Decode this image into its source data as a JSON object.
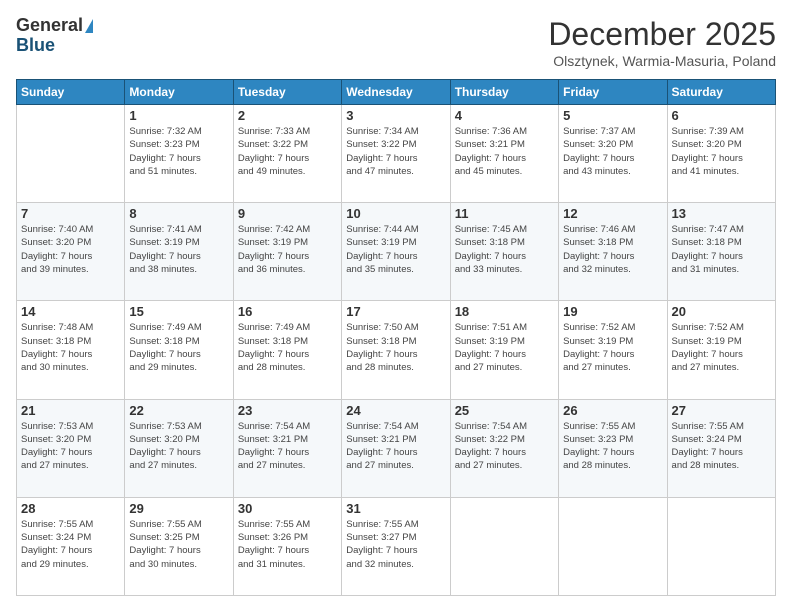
{
  "logo": {
    "general": "General",
    "blue": "Blue"
  },
  "title": "December 2025",
  "location": "Olsztynek, Warmia-Masuria, Poland",
  "days_header": [
    "Sunday",
    "Monday",
    "Tuesday",
    "Wednesday",
    "Thursday",
    "Friday",
    "Saturday"
  ],
  "weeks": [
    [
      {
        "day": "",
        "info": ""
      },
      {
        "day": "1",
        "info": "Sunrise: 7:32 AM\nSunset: 3:23 PM\nDaylight: 7 hours\nand 51 minutes."
      },
      {
        "day": "2",
        "info": "Sunrise: 7:33 AM\nSunset: 3:22 PM\nDaylight: 7 hours\nand 49 minutes."
      },
      {
        "day": "3",
        "info": "Sunrise: 7:34 AM\nSunset: 3:22 PM\nDaylight: 7 hours\nand 47 minutes."
      },
      {
        "day": "4",
        "info": "Sunrise: 7:36 AM\nSunset: 3:21 PM\nDaylight: 7 hours\nand 45 minutes."
      },
      {
        "day": "5",
        "info": "Sunrise: 7:37 AM\nSunset: 3:20 PM\nDaylight: 7 hours\nand 43 minutes."
      },
      {
        "day": "6",
        "info": "Sunrise: 7:39 AM\nSunset: 3:20 PM\nDaylight: 7 hours\nand 41 minutes."
      }
    ],
    [
      {
        "day": "7",
        "info": "Sunrise: 7:40 AM\nSunset: 3:20 PM\nDaylight: 7 hours\nand 39 minutes."
      },
      {
        "day": "8",
        "info": "Sunrise: 7:41 AM\nSunset: 3:19 PM\nDaylight: 7 hours\nand 38 minutes."
      },
      {
        "day": "9",
        "info": "Sunrise: 7:42 AM\nSunset: 3:19 PM\nDaylight: 7 hours\nand 36 minutes."
      },
      {
        "day": "10",
        "info": "Sunrise: 7:44 AM\nSunset: 3:19 PM\nDaylight: 7 hours\nand 35 minutes."
      },
      {
        "day": "11",
        "info": "Sunrise: 7:45 AM\nSunset: 3:18 PM\nDaylight: 7 hours\nand 33 minutes."
      },
      {
        "day": "12",
        "info": "Sunrise: 7:46 AM\nSunset: 3:18 PM\nDaylight: 7 hours\nand 32 minutes."
      },
      {
        "day": "13",
        "info": "Sunrise: 7:47 AM\nSunset: 3:18 PM\nDaylight: 7 hours\nand 31 minutes."
      }
    ],
    [
      {
        "day": "14",
        "info": "Sunrise: 7:48 AM\nSunset: 3:18 PM\nDaylight: 7 hours\nand 30 minutes."
      },
      {
        "day": "15",
        "info": "Sunrise: 7:49 AM\nSunset: 3:18 PM\nDaylight: 7 hours\nand 29 minutes."
      },
      {
        "day": "16",
        "info": "Sunrise: 7:49 AM\nSunset: 3:18 PM\nDaylight: 7 hours\nand 28 minutes."
      },
      {
        "day": "17",
        "info": "Sunrise: 7:50 AM\nSunset: 3:18 PM\nDaylight: 7 hours\nand 28 minutes."
      },
      {
        "day": "18",
        "info": "Sunrise: 7:51 AM\nSunset: 3:19 PM\nDaylight: 7 hours\nand 27 minutes."
      },
      {
        "day": "19",
        "info": "Sunrise: 7:52 AM\nSunset: 3:19 PM\nDaylight: 7 hours\nand 27 minutes."
      },
      {
        "day": "20",
        "info": "Sunrise: 7:52 AM\nSunset: 3:19 PM\nDaylight: 7 hours\nand 27 minutes."
      }
    ],
    [
      {
        "day": "21",
        "info": "Sunrise: 7:53 AM\nSunset: 3:20 PM\nDaylight: 7 hours\nand 27 minutes."
      },
      {
        "day": "22",
        "info": "Sunrise: 7:53 AM\nSunset: 3:20 PM\nDaylight: 7 hours\nand 27 minutes."
      },
      {
        "day": "23",
        "info": "Sunrise: 7:54 AM\nSunset: 3:21 PM\nDaylight: 7 hours\nand 27 minutes."
      },
      {
        "day": "24",
        "info": "Sunrise: 7:54 AM\nSunset: 3:21 PM\nDaylight: 7 hours\nand 27 minutes."
      },
      {
        "day": "25",
        "info": "Sunrise: 7:54 AM\nSunset: 3:22 PM\nDaylight: 7 hours\nand 27 minutes."
      },
      {
        "day": "26",
        "info": "Sunrise: 7:55 AM\nSunset: 3:23 PM\nDaylight: 7 hours\nand 28 minutes."
      },
      {
        "day": "27",
        "info": "Sunrise: 7:55 AM\nSunset: 3:24 PM\nDaylight: 7 hours\nand 28 minutes."
      }
    ],
    [
      {
        "day": "28",
        "info": "Sunrise: 7:55 AM\nSunset: 3:24 PM\nDaylight: 7 hours\nand 29 minutes."
      },
      {
        "day": "29",
        "info": "Sunrise: 7:55 AM\nSunset: 3:25 PM\nDaylight: 7 hours\nand 30 minutes."
      },
      {
        "day": "30",
        "info": "Sunrise: 7:55 AM\nSunset: 3:26 PM\nDaylight: 7 hours\nand 31 minutes."
      },
      {
        "day": "31",
        "info": "Sunrise: 7:55 AM\nSunset: 3:27 PM\nDaylight: 7 hours\nand 32 minutes."
      },
      {
        "day": "",
        "info": ""
      },
      {
        "day": "",
        "info": ""
      },
      {
        "day": "",
        "info": ""
      }
    ]
  ]
}
